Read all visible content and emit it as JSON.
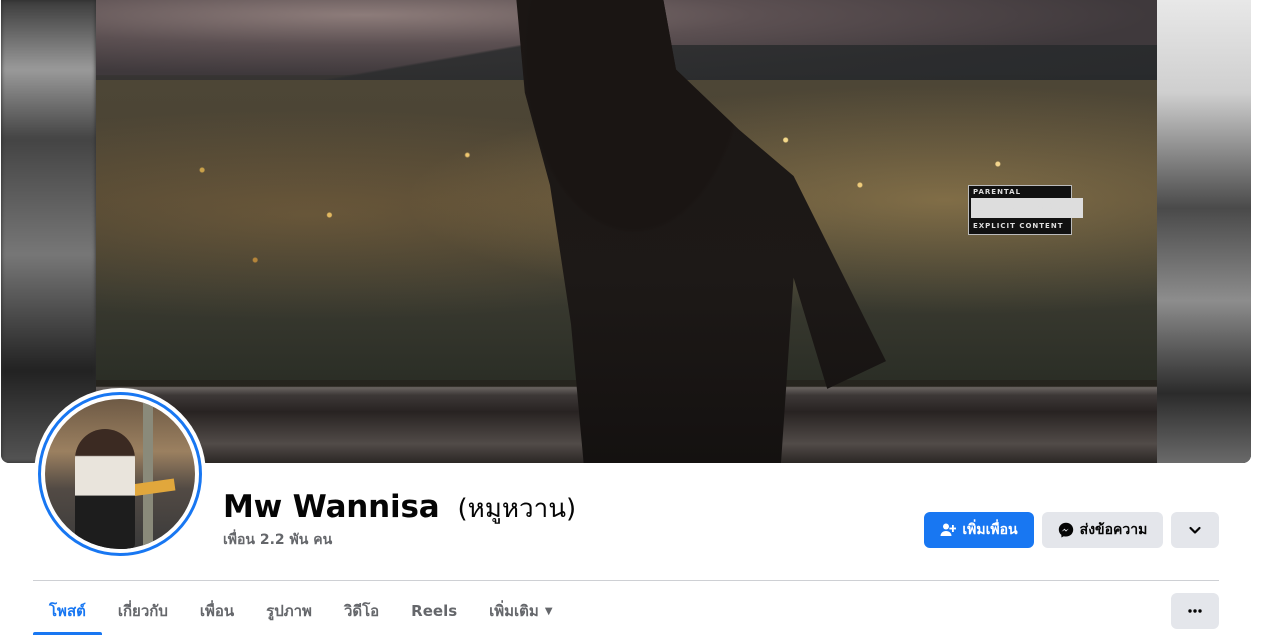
{
  "profile": {
    "name": "Mw Wannisa",
    "alternate_name": "(หมูหวาน)",
    "friends": "เพื่อน 2.2 พัน คน"
  },
  "cover": {
    "advisory_top": "PARENTAL",
    "advisory_main": "ADVISORY",
    "advisory_bottom": "EXPLICIT CONTENT"
  },
  "actions": {
    "add_friend": "เพิ่มเพื่อน",
    "message": "ส่งข้อความ",
    "more_icon": "chevron-down-icon"
  },
  "tabs": [
    {
      "label": "โพสต์",
      "active": true
    },
    {
      "label": "เกี่ยวกับ",
      "active": false
    },
    {
      "label": "เพื่อน",
      "active": false
    },
    {
      "label": "รูปภาพ",
      "active": false
    },
    {
      "label": "วิดีโอ",
      "active": false
    },
    {
      "label": "Reels",
      "active": false
    },
    {
      "label": "เพิ่มเติม",
      "active": false
    }
  ],
  "colors": {
    "accent": "#1877f2",
    "secondary_button": "#e4e6eb",
    "muted_text": "#65676b"
  }
}
